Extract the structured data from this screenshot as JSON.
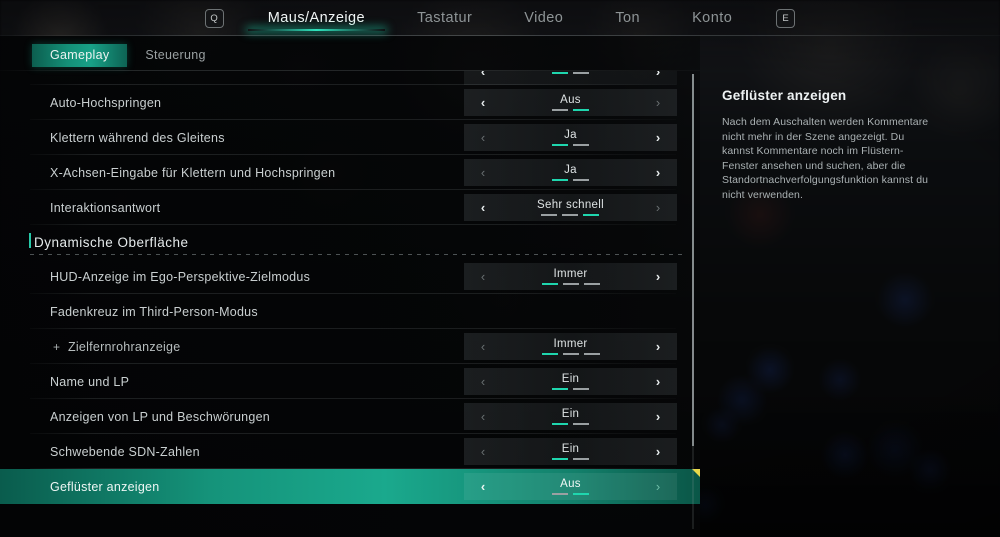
{
  "header": {
    "left_key": "Q",
    "right_key": "E",
    "tabs": [
      {
        "label": "Maus/Anzeige",
        "active": true
      },
      {
        "label": "Tastatur",
        "active": false
      },
      {
        "label": "Video",
        "active": false
      },
      {
        "label": "Ton",
        "active": false
      },
      {
        "label": "Konto",
        "active": false
      }
    ]
  },
  "subtabs": [
    {
      "label": "Gameplay",
      "active": true
    },
    {
      "label": "Steuerung",
      "active": false
    }
  ],
  "accent_color": "#1aa98d",
  "accent_dot_color": "#1fd6ae",
  "flag_color": "#e8d84a",
  "rows": [
    {
      "type": "partial",
      "label": "",
      "value": "",
      "dots": 2,
      "active_dot": 1,
      "left_enabled": true,
      "right_enabled": true
    },
    {
      "type": "setting",
      "label": "Auto-Hochspringen",
      "value": "Aus",
      "dots": 2,
      "active_dot": 2,
      "left_enabled": true,
      "right_enabled": false
    },
    {
      "type": "setting",
      "label": "Klettern während des Gleitens",
      "value": "Ja",
      "dots": 2,
      "active_dot": 1,
      "left_enabled": false,
      "right_enabled": true
    },
    {
      "type": "setting",
      "label": "X-Achsen-Eingabe für Klettern und Hochspringen",
      "value": "Ja",
      "dots": 2,
      "active_dot": 1,
      "left_enabled": false,
      "right_enabled": true
    },
    {
      "type": "setting",
      "label": "Interaktionsantwort",
      "value": "Sehr schnell",
      "dots": 3,
      "active_dot": 3,
      "left_enabled": true,
      "right_enabled": false
    },
    {
      "type": "section",
      "label": "Dynamische Oberfläche"
    },
    {
      "type": "setting",
      "label": "HUD-Anzeige im Ego-Perspektive-Zielmodus",
      "value": "Immer",
      "dots": 3,
      "active_dot": 1,
      "left_enabled": false,
      "right_enabled": true
    },
    {
      "type": "nocontrol",
      "label": "Fadenkreuz im Third-Person-Modus"
    },
    {
      "type": "sub",
      "label": "Zielfernrohranzeige",
      "expander": "+",
      "value": "Immer",
      "dots": 3,
      "active_dot": 1,
      "left_enabled": false,
      "right_enabled": true
    },
    {
      "type": "setting",
      "label": "Name und LP",
      "value": "Ein",
      "dots": 2,
      "active_dot": 1,
      "left_enabled": false,
      "right_enabled": true
    },
    {
      "type": "setting",
      "label": "Anzeigen von LP und Beschwörungen",
      "value": "Ein",
      "dots": 2,
      "active_dot": 1,
      "left_enabled": false,
      "right_enabled": true
    },
    {
      "type": "setting",
      "label": "Schwebende SDN-Zahlen",
      "value": "Ein",
      "dots": 2,
      "active_dot": 1,
      "left_enabled": false,
      "right_enabled": true
    },
    {
      "type": "selected",
      "label": "Geflüster anzeigen",
      "value": "Aus",
      "dots": 2,
      "active_dot": 2,
      "left_enabled": true,
      "right_enabled": false
    }
  ],
  "detail": {
    "title": "Geflüster anzeigen",
    "description": "Nach dem Auschalten werden Kommentare nicht mehr in der Szene angezeigt. Du kannst Kommentare noch im Flüstern-Fenster ansehen und suchen, aber die Standortnachverfolgungsfunktion kannst du nicht verwenden."
  },
  "icons": {
    "arrow_left": "‹",
    "arrow_right": "›"
  }
}
